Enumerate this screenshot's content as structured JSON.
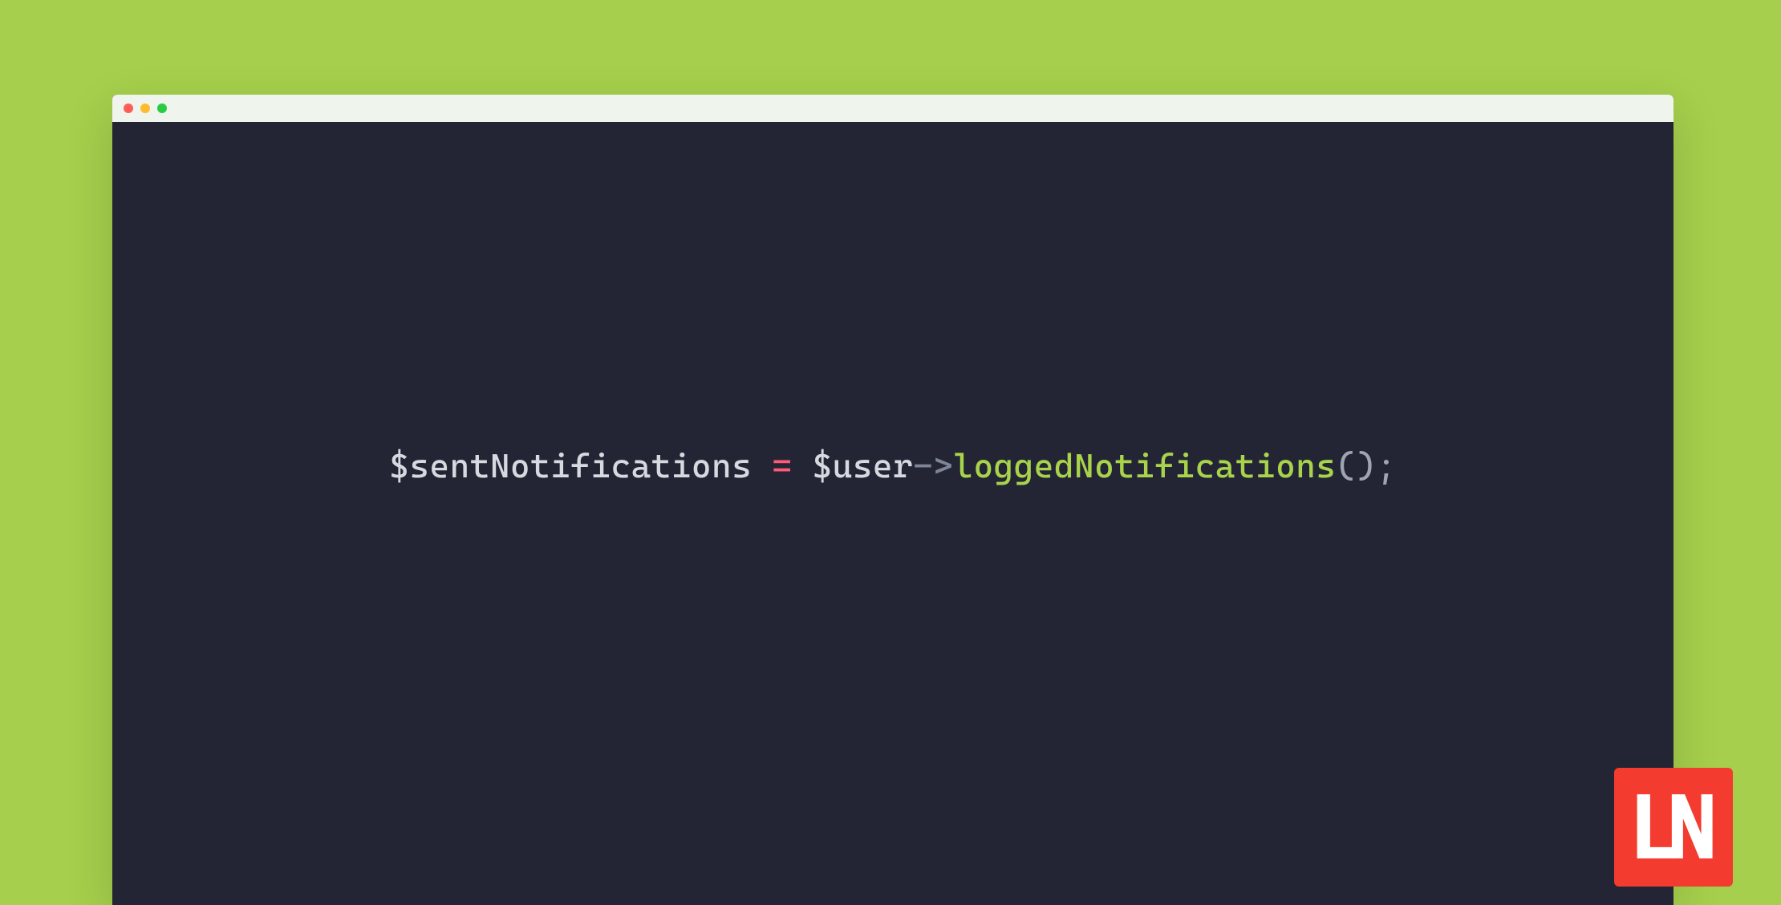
{
  "code": {
    "t1": "$sentNotifications",
    "sp1": " ",
    "t2": "=",
    "sp2": " ",
    "t3": "$user",
    "t4": "->",
    "t5": "loggedNotifications",
    "t6": "();"
  },
  "badge": {
    "letters": "LN"
  }
}
